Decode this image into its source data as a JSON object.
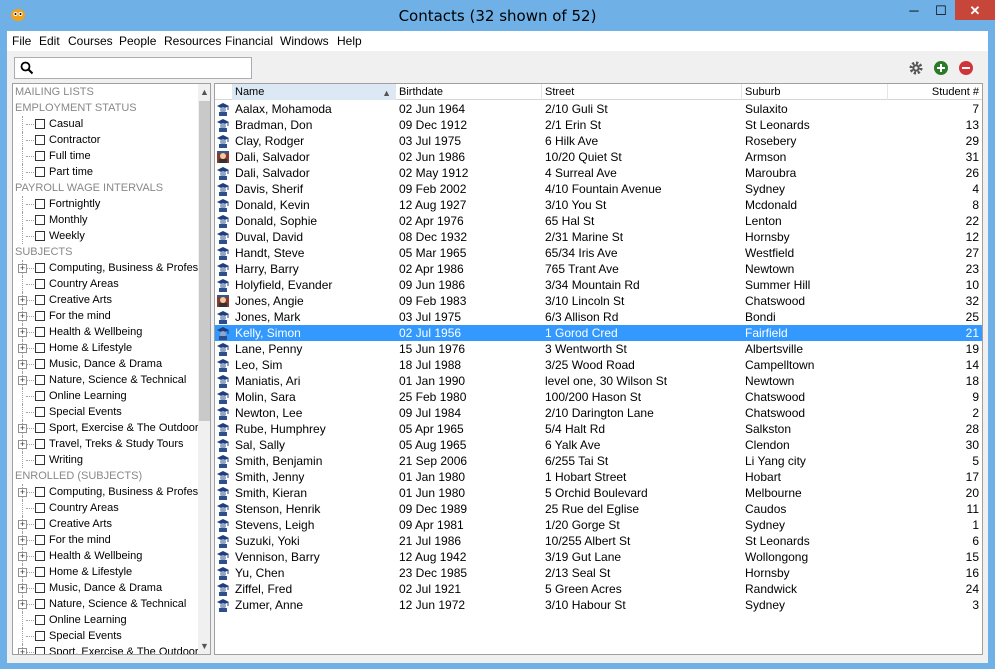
{
  "window": {
    "title": "Contacts (32 shown of 52)",
    "min_glyph": "─",
    "max_glyph": "☐",
    "close_glyph": "✕"
  },
  "menu": [
    "File",
    "Edit",
    "Courses",
    "People",
    "Resources",
    "Financial",
    "Windows",
    "Help"
  ],
  "search": {
    "value": "",
    "placeholder": ""
  },
  "toolbar_icons": [
    "gear-icon",
    "add-icon",
    "remove-icon"
  ],
  "colors": {
    "selected_row": "#3399ff",
    "add": "#2a7a2a",
    "remove": "#d13438",
    "titlebar": "#6fb1e6"
  },
  "sidebar": {
    "rows": [
      {
        "type": "heading",
        "label": "MAILING LISTS"
      },
      {
        "type": "heading",
        "label": "EMPLOYMENT STATUS"
      },
      {
        "type": "item",
        "label": "Casual",
        "expandable": false
      },
      {
        "type": "item",
        "label": "Contractor",
        "expandable": false
      },
      {
        "type": "item",
        "label": "Full time",
        "expandable": false
      },
      {
        "type": "item",
        "label": "Part time",
        "expandable": false
      },
      {
        "type": "heading",
        "label": "PAYROLL WAGE INTERVALS"
      },
      {
        "type": "item",
        "label": "Fortnightly",
        "expandable": false
      },
      {
        "type": "item",
        "label": "Monthly",
        "expandable": false
      },
      {
        "type": "item",
        "label": "Weekly",
        "expandable": false
      },
      {
        "type": "heading",
        "label": "SUBJECTS"
      },
      {
        "type": "item",
        "label": "Computing, Business & Profes",
        "expandable": true
      },
      {
        "type": "item",
        "label": "Country Areas",
        "expandable": false
      },
      {
        "type": "item",
        "label": "Creative Arts",
        "expandable": true
      },
      {
        "type": "item",
        "label": "For the mind",
        "expandable": true
      },
      {
        "type": "item",
        "label": "Health & Wellbeing",
        "expandable": true
      },
      {
        "type": "item",
        "label": "Home & Lifestyle",
        "expandable": true
      },
      {
        "type": "item",
        "label": "Music, Dance & Drama",
        "expandable": true
      },
      {
        "type": "item",
        "label": "Nature, Science & Technical",
        "expandable": true
      },
      {
        "type": "item",
        "label": "Online Learning",
        "expandable": false
      },
      {
        "type": "item",
        "label": "Special Events",
        "expandable": false
      },
      {
        "type": "item",
        "label": "Sport, Exercise & The Outdoor",
        "expandable": true
      },
      {
        "type": "item",
        "label": "Travel, Treks & Study Tours",
        "expandable": true
      },
      {
        "type": "item",
        "label": "Writing",
        "expandable": false
      },
      {
        "type": "heading",
        "label": "ENROLLED (SUBJECTS)"
      },
      {
        "type": "item",
        "label": "Computing, Business & Profes",
        "expandable": true
      },
      {
        "type": "item",
        "label": "Country Areas",
        "expandable": false
      },
      {
        "type": "item",
        "label": "Creative Arts",
        "expandable": true
      },
      {
        "type": "item",
        "label": "For the mind",
        "expandable": true
      },
      {
        "type": "item",
        "label": "Health & Wellbeing",
        "expandable": true
      },
      {
        "type": "item",
        "label": "Home & Lifestyle",
        "expandable": true
      },
      {
        "type": "item",
        "label": "Music, Dance & Drama",
        "expandable": true
      },
      {
        "type": "item",
        "label": "Nature, Science & Technical",
        "expandable": true
      },
      {
        "type": "item",
        "label": "Online Learning",
        "expandable": false
      },
      {
        "type": "item",
        "label": "Special Events",
        "expandable": false
      },
      {
        "type": "item",
        "label": "Sport, Exercise & The Outdoor",
        "expandable": true
      }
    ]
  },
  "grid": {
    "columns": [
      "Name",
      "Birthdate",
      "Street",
      "Suburb",
      "Student #"
    ],
    "sorted_column": "Name",
    "selected_index": 14,
    "rows": [
      {
        "name": "Aalax, Mohamoda",
        "birthdate": "02 Jun 1964",
        "street": "2/10 Guli St",
        "suburb": "Sulaxito",
        "student": "7",
        "icon": "student"
      },
      {
        "name": "Bradman, Don",
        "birthdate": "09 Dec 1912",
        "street": "2/1 Erin St",
        "suburb": "St Leonards",
        "student": "13",
        "icon": "student"
      },
      {
        "name": "Clay, Rodger",
        "birthdate": "03 Jul 1975",
        "street": "6 Hilk Ave",
        "suburb": "Rosebery",
        "student": "29",
        "icon": "student"
      },
      {
        "name": "Dali, Salvador",
        "birthdate": "02 Jun 1986",
        "street": "10/20 Quiet St",
        "suburb": "Armson",
        "student": "31",
        "icon": "tutor"
      },
      {
        "name": "Dali, Salvador",
        "birthdate": "02 May 1912",
        "street": "4 Surreal Ave",
        "suburb": "Maroubra",
        "student": "26",
        "icon": "student"
      },
      {
        "name": "Davis, Sherif",
        "birthdate": "09 Feb 2002",
        "street": "4/10 Fountain Avenue",
        "suburb": "Sydney",
        "student": "4",
        "icon": "student"
      },
      {
        "name": "Donald, Kevin",
        "birthdate": "12 Aug 1927",
        "street": "3/10 You St",
        "suburb": "Mcdonald",
        "student": "8",
        "icon": "student"
      },
      {
        "name": "Donald, Sophie",
        "birthdate": "02 Apr 1976",
        "street": "65 Hal St",
        "suburb": "Lenton",
        "student": "22",
        "icon": "student"
      },
      {
        "name": "Duval, David",
        "birthdate": "08 Dec 1932",
        "street": "2/31 Marine St",
        "suburb": "Hornsby",
        "student": "12",
        "icon": "student"
      },
      {
        "name": "Handt, Steve",
        "birthdate": "05 Mar 1965",
        "street": "65/34 Iris Ave",
        "suburb": "Westfield",
        "student": "27",
        "icon": "student"
      },
      {
        "name": "Harry, Barry",
        "birthdate": "02 Apr 1986",
        "street": "765 Trant Ave",
        "suburb": "Newtown",
        "student": "23",
        "icon": "student"
      },
      {
        "name": "Holyfield, Evander",
        "birthdate": "09 Jun 1986",
        "street": "3/34 Mountain Rd",
        "suburb": "Summer Hill",
        "student": "10",
        "icon": "student"
      },
      {
        "name": "Jones, Angie",
        "birthdate": "09 Feb 1983",
        "street": "3/10 Lincoln St",
        "suburb": "Chatswood",
        "student": "32",
        "icon": "tutor"
      },
      {
        "name": "Jones, Mark",
        "birthdate": "03 Jul 1975",
        "street": "6/3 Allison Rd",
        "suburb": "Bondi",
        "student": "25",
        "icon": "student"
      },
      {
        "name": "Kelly, Simon",
        "birthdate": "02 Jul 1956",
        "street": "1 Gorod Cred",
        "suburb": "Fairfield",
        "student": "21",
        "icon": "student"
      },
      {
        "name": "Lane, Penny",
        "birthdate": "15 Jun 1976",
        "street": "3 Wentworth St",
        "suburb": "Albertsville",
        "student": "19",
        "icon": "student"
      },
      {
        "name": "Leo, Sim",
        "birthdate": "18 Jul 1988",
        "street": "3/25 Wood Road",
        "suburb": "Campelltown",
        "student": "14",
        "icon": "student"
      },
      {
        "name": "Maniatis, Ari",
        "birthdate": "01 Jan 1990",
        "street": "level one, 30 Wilson St",
        "suburb": "Newtown",
        "student": "18",
        "icon": "student"
      },
      {
        "name": "Molin, Sara",
        "birthdate": "25 Feb 1980",
        "street": "100/200 Hason St",
        "suburb": "Chatswood",
        "student": "9",
        "icon": "student"
      },
      {
        "name": "Newton, Lee",
        "birthdate": "09 Jul 1984",
        "street": "2/10 Darington Lane",
        "suburb": "Chatswood",
        "student": "2",
        "icon": "student"
      },
      {
        "name": "Rube, Humphrey",
        "birthdate": "05 Apr 1965",
        "street": "5/4 Halt Rd",
        "suburb": "Salkston",
        "student": "28",
        "icon": "student"
      },
      {
        "name": "Sal, Sally",
        "birthdate": "05 Aug 1965",
        "street": "6 Yalk Ave",
        "suburb": "Clendon",
        "student": "30",
        "icon": "student"
      },
      {
        "name": "Smith, Benjamin",
        "birthdate": "21 Sep 2006",
        "street": "6/255 Tai St",
        "suburb": "Li Yang city",
        "student": "5",
        "icon": "student"
      },
      {
        "name": "Smith, Jenny",
        "birthdate": "01 Jan 1980",
        "street": "1 Hobart Street",
        "suburb": "Hobart",
        "student": "17",
        "icon": "student"
      },
      {
        "name": "Smith, Kieran",
        "birthdate": "01 Jun 1980",
        "street": "5 Orchid Boulevard",
        "suburb": "Melbourne",
        "student": "20",
        "icon": "student"
      },
      {
        "name": "Stenson, Henrik",
        "birthdate": "09 Dec 1989",
        "street": "25 Rue del Eglise",
        "suburb": "Caudos",
        "student": "11",
        "icon": "student"
      },
      {
        "name": "Stevens, Leigh",
        "birthdate": "09 Apr 1981",
        "street": "1/20 Gorge St",
        "suburb": "Sydney",
        "student": "1",
        "icon": "student"
      },
      {
        "name": "Suzuki, Yoki",
        "birthdate": "21 Jul 1986",
        "street": "10/255 Albert St",
        "suburb": "St Leonards",
        "student": "6",
        "icon": "student"
      },
      {
        "name": "Vennison, Barry",
        "birthdate": "12 Aug 1942",
        "street": "3/19 Gut Lane",
        "suburb": "Wollongong",
        "student": "15",
        "icon": "student"
      },
      {
        "name": "Yu, Chen",
        "birthdate": "23 Dec 1985",
        "street": "2/13 Seal St",
        "suburb": "Hornsby",
        "student": "16",
        "icon": "student"
      },
      {
        "name": "Ziffel, Fred",
        "birthdate": "02 Jul 1921",
        "street": "5 Green Acres",
        "suburb": "Randwick",
        "student": "24",
        "icon": "student"
      },
      {
        "name": "Zumer, Anne",
        "birthdate": "12 Jun 1972",
        "street": "3/10 Habour St",
        "suburb": "Sydney",
        "student": "3",
        "icon": "student"
      }
    ]
  }
}
